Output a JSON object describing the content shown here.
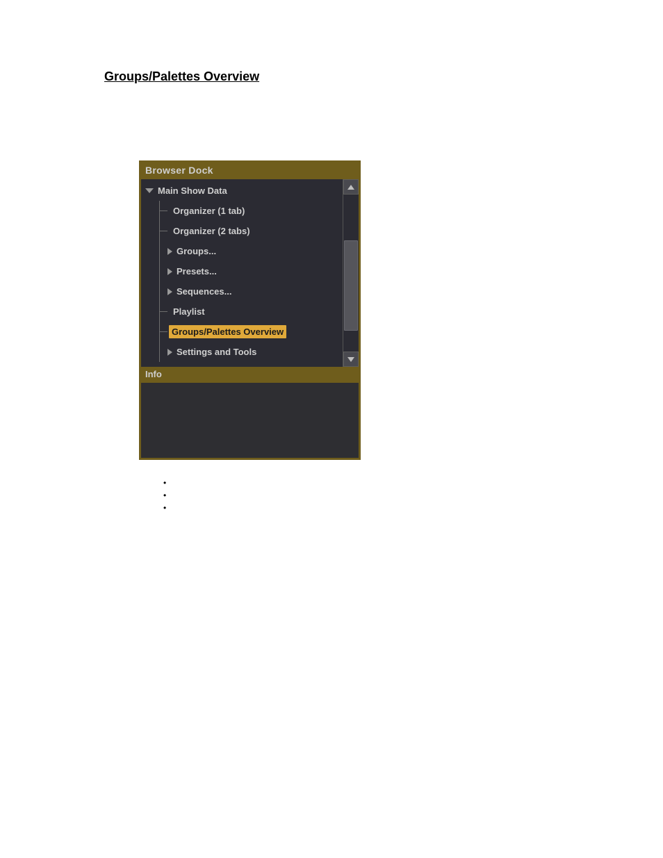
{
  "section_link": "Groups/Palettes Overview",
  "panel": {
    "title": "Browser Dock",
    "info_title": "Info",
    "tree": {
      "root": "Main Show Data",
      "items": {
        "org1": "Organizer (1 tab)",
        "org2": "Organizer (2 tabs)",
        "groups": "Groups...",
        "presets": "Presets...",
        "sequences": "Sequences...",
        "playlist": "Playlist",
        "overview": "Groups/Palettes Overview",
        "settings": "Settings and Tools"
      }
    }
  }
}
